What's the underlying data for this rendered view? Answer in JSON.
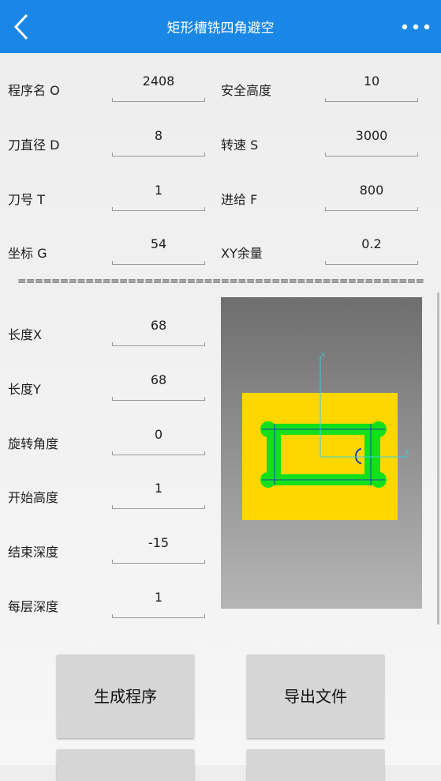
{
  "header": {
    "title": "矩形槽铣四角避空"
  },
  "params": {
    "program_name": {
      "label": "程序名 O",
      "value": "2408"
    },
    "safe_height": {
      "label": "安全高度",
      "value": "10"
    },
    "tool_diameter": {
      "label": "刀直径 D",
      "value": "8"
    },
    "spindle_speed": {
      "label": "转速 S",
      "value": "3000"
    },
    "tool_number": {
      "label": "刀号 T",
      "value": "1"
    },
    "feed": {
      "label": "进给 F",
      "value": "800"
    },
    "coordinate": {
      "label": "坐标 G",
      "value": "54"
    },
    "xy_allowance": {
      "label": "XY余量",
      "value": "0.2"
    }
  },
  "separator": "================================================",
  "shape": {
    "length_x": {
      "label": "长度X",
      "value": "68"
    },
    "length_y": {
      "label": "长度Y",
      "value": "68"
    },
    "rotation": {
      "label": "旋转角度",
      "value": "0"
    },
    "start_height": {
      "label": "开始高度",
      "value": "1"
    },
    "end_depth": {
      "label": "结束深度",
      "value": "-15"
    },
    "step_depth": {
      "label": "每层深度",
      "value": "1"
    }
  },
  "preview": {
    "axis_x": "X",
    "axis_y": "Y"
  },
  "buttons": {
    "generate": "生成程序",
    "export": "导出文件"
  },
  "colors": {
    "header": "#1a87e6",
    "stock": "#ffd700",
    "toolpath": "#12e01a",
    "axis": "#35d0e6"
  }
}
